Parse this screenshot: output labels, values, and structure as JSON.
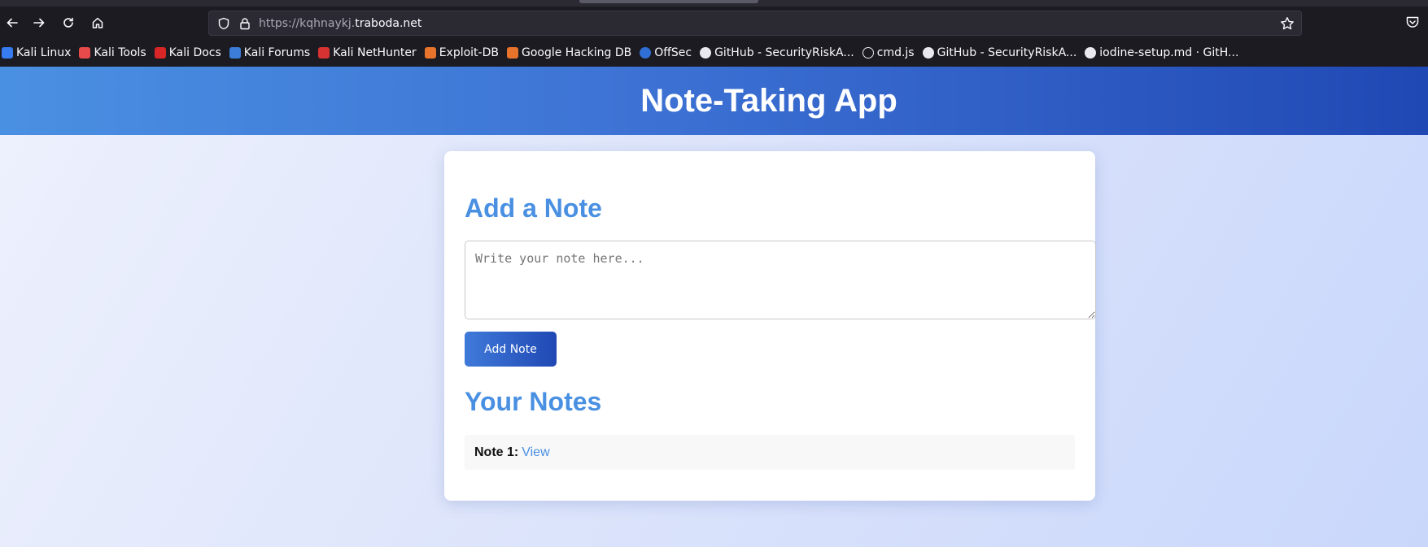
{
  "browser": {
    "url_prefix": "https://kqhnaykj.",
    "url_domain": "traboda.net",
    "bookmarks": [
      {
        "label": "Kali Linux",
        "color": "#367bf0"
      },
      {
        "label": "Kali Tools",
        "color": "#e64a4a"
      },
      {
        "label": "Kali Docs",
        "color": "#d82626"
      },
      {
        "label": "Kali Forums",
        "color": "#3b7dd8"
      },
      {
        "label": "Kali NetHunter",
        "color": "#d93232"
      },
      {
        "label": "Exploit-DB",
        "color": "#e8742b"
      },
      {
        "label": "Google Hacking DB",
        "color": "#e8742b"
      },
      {
        "label": "OffSec",
        "color": "#2f6fd6"
      },
      {
        "label": "GitHub - SecurityRiskA...",
        "color": "#e9e9ef"
      },
      {
        "label": "cmd.js",
        "color": "#e9e9ef"
      },
      {
        "label": "GitHub - SecurityRiskA...",
        "color": "#e9e9ef"
      },
      {
        "label": "iodine-setup.md · GitH...",
        "color": "#e9e9ef"
      }
    ]
  },
  "app": {
    "title": "Note-Taking App",
    "add_section_title": "Add a Note",
    "note_placeholder": "Write your note here...",
    "add_button_label": "Add Note",
    "notes_section_title": "Your Notes",
    "notes": [
      {
        "label": "Note 1:",
        "link": "View"
      }
    ]
  },
  "colors": {
    "accent": "#4a90e2",
    "header_end": "#2048b4"
  }
}
